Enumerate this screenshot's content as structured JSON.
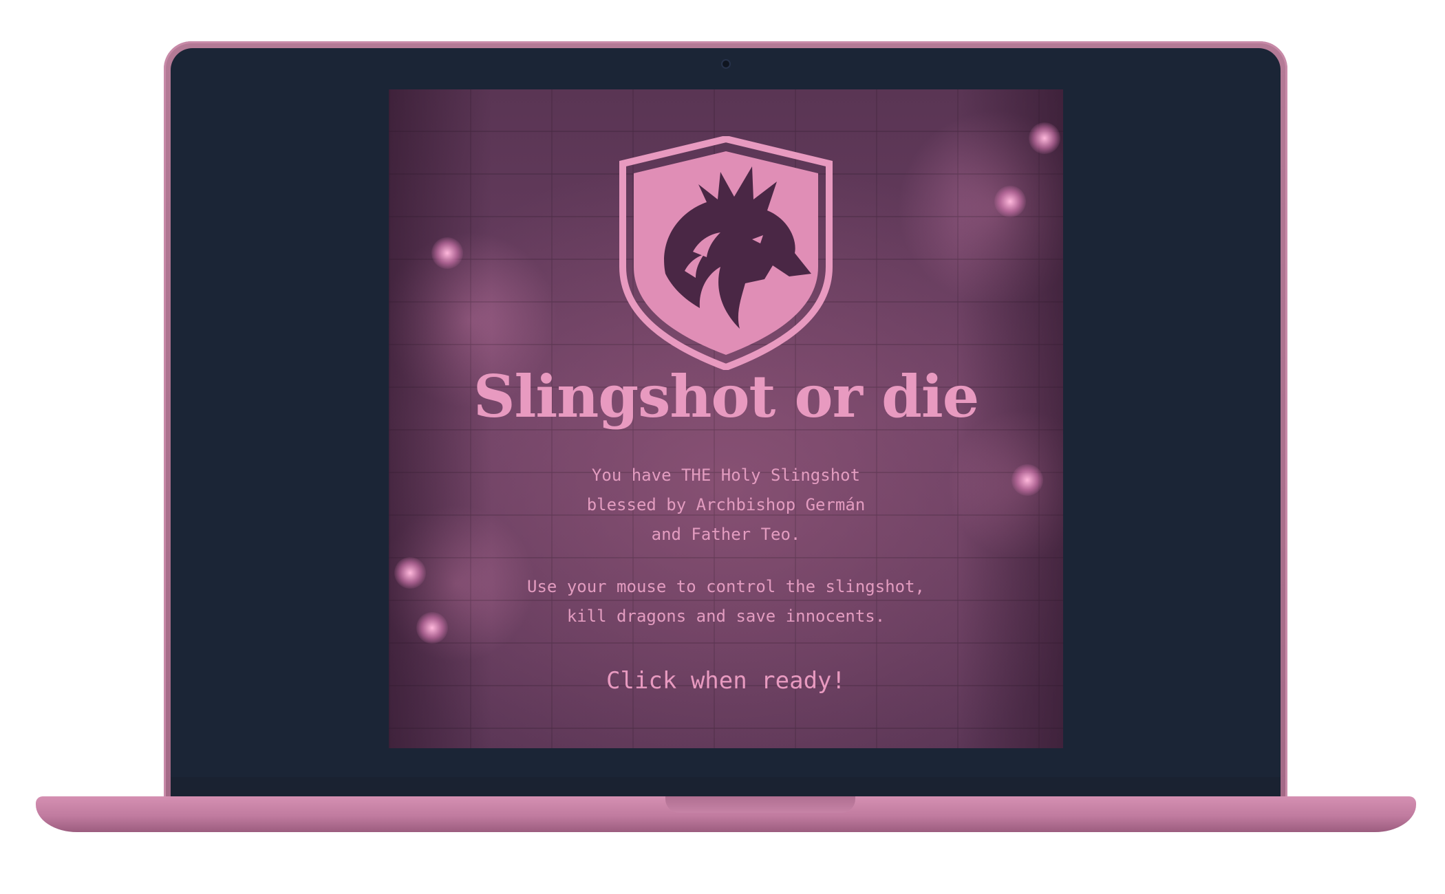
{
  "game": {
    "title": "Slingshot or die",
    "intro_lines": [
      "You have THE Holy Slingshot",
      "blessed by Archbishop Germán",
      "and Father Teo."
    ],
    "instruction_lines": [
      "Use your mouse to control the slingshot,",
      "kill dragons and save innocents."
    ],
    "start_prompt": "Click when ready!",
    "crest_icon": "dragon-shield-icon"
  },
  "colors": {
    "accent_pink": "#e89ac0",
    "screen_bg": "#6b4063",
    "bezel": "#1b2536",
    "laptop_body": "#c07b9f"
  }
}
